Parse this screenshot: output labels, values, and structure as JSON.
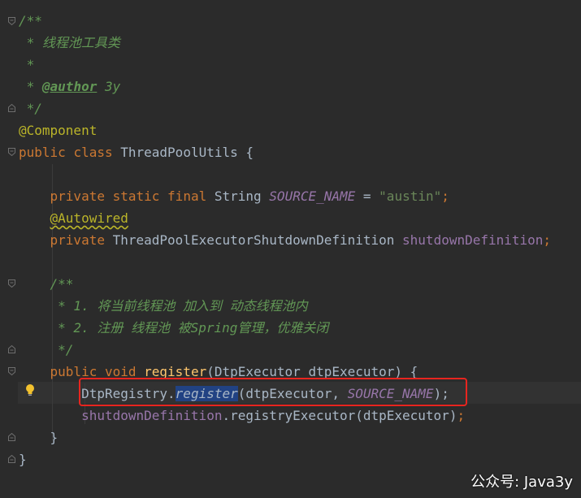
{
  "code": {
    "doc1_open": "/**",
    "doc1_line1": " * 线程池工具类",
    "doc1_line2": " *",
    "doc1_line3_prefix": " * ",
    "doc1_author_tag": "@author",
    "doc1_author_value": " 3y",
    "doc1_close": " */",
    "class_annotation": "@Component",
    "kw_public": "public",
    "kw_class": "class",
    "class_name": "ThreadPoolUtils",
    "open_brace": " {",
    "kw_private": "private",
    "kw_static": "static",
    "kw_final": "final",
    "type_string": "String",
    "const_name": "SOURCE_NAME",
    "assign": " = ",
    "const_value": "\"austin\"",
    "semicolon": ";",
    "field_annotation": "@Autowired",
    "field_type": "ThreadPoolExecutorShutdownDefinition",
    "field_name": "shutdownDefinition",
    "doc2_open": "/**",
    "doc2_line1": " * 1. 将当前线程池 加入到 动态线程池内",
    "doc2_line2_a": " * 2. 注册 线程池 被",
    "doc2_line2_b": "Spring",
    "doc2_line2_c": "管理，优雅关闭",
    "doc2_close": " */",
    "kw_void": "void",
    "method_name": "register",
    "param_open": "(",
    "param_type": "DtpExecutor",
    "param_name": " dtpExecutor",
    "param_close": ") {",
    "call1_class": "DtpRegistry",
    "dot": ".",
    "call1_method": "register",
    "call1_args_a": "(dtpExecutor, ",
    "call1_args_const": "SOURCE_NAME",
    "call1_args_close": ");",
    "call2_target": "shutdownDefinition",
    "call2_method": "registryExecutor",
    "call2_args": "(dtpExecutor)",
    "method_close": "}",
    "class_close": "}"
  },
  "watermark": "公众号: Java3y",
  "icons": {
    "intention": "lightbulb-icon",
    "fold": "fold-marker-icon"
  },
  "colors": {
    "background": "#2b2b2b",
    "keyword": "#cc7832",
    "annotation": "#bbb529",
    "doc_comment": "#629755",
    "field": "#9876aa",
    "string": "#6a8759",
    "method_decl": "#ffc66d",
    "highlight_box": "#e8251f",
    "selection": "#214283"
  }
}
